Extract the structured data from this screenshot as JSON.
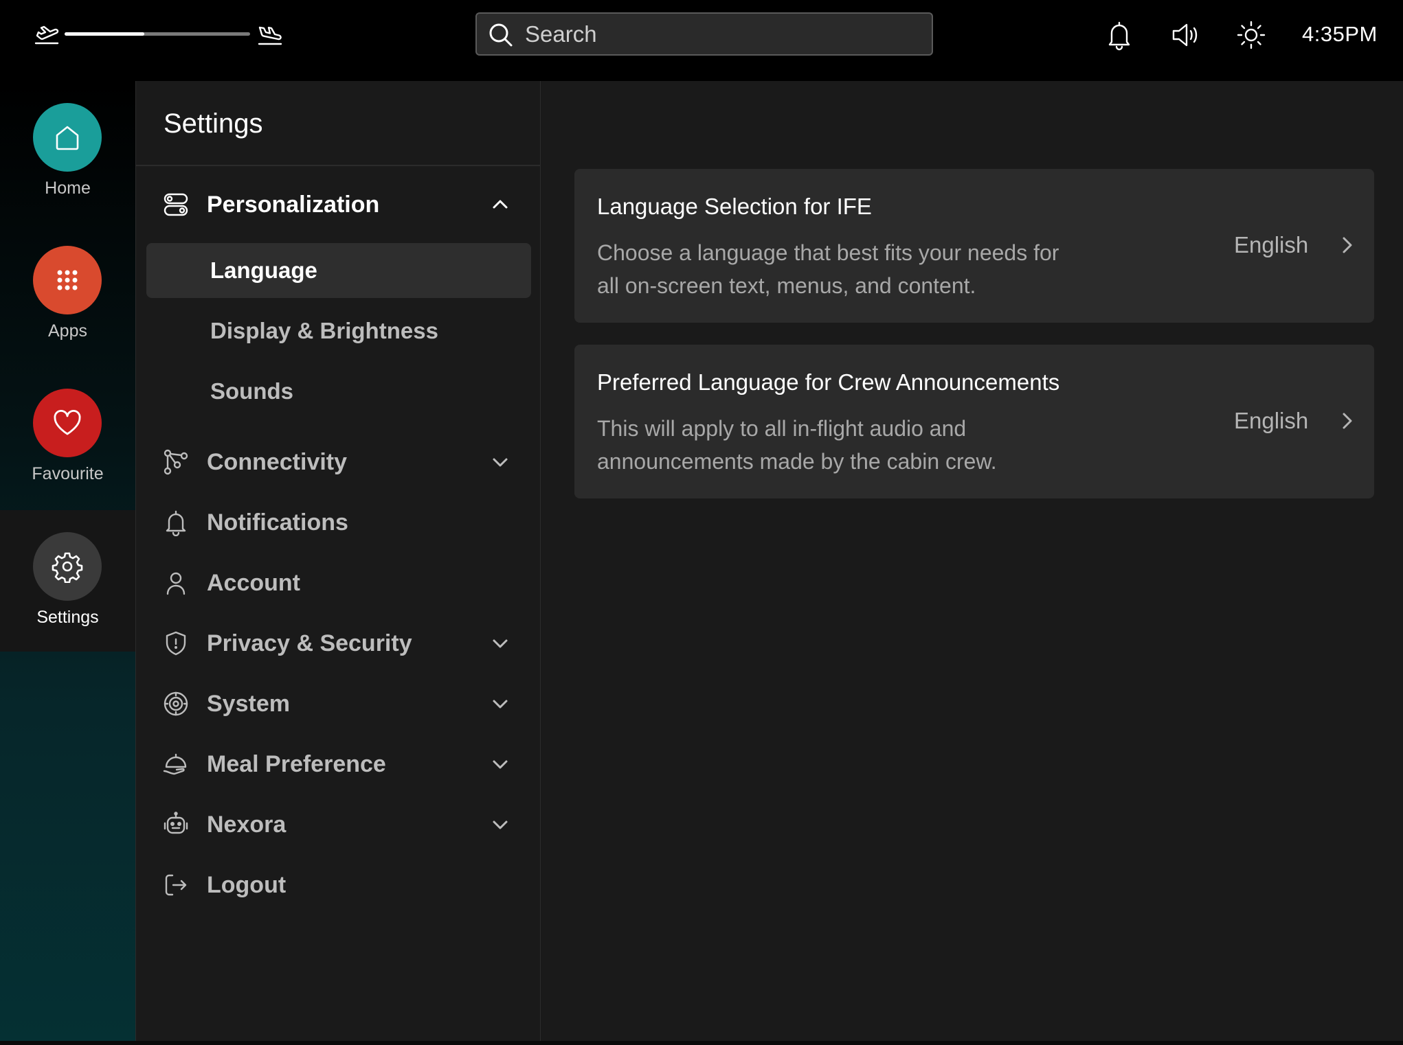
{
  "topbar": {
    "flight_progress": 0.43,
    "departure_icon": "plane-takeoff-icon",
    "arrival_icon": "plane-landing-icon",
    "search_placeholder": "Search",
    "icons": [
      "bell-icon",
      "volume-icon",
      "brightness-icon"
    ],
    "time": "4:35PM"
  },
  "rail": {
    "items": [
      {
        "label": "Home",
        "icon": "home-icon",
        "color": "#1a9e9a"
      },
      {
        "label": "Apps",
        "icon": "apps-grid-icon",
        "color": "#d94a2e"
      },
      {
        "label": "Favourite",
        "icon": "heart-icon",
        "color": "#c81e1e"
      },
      {
        "label": "Settings",
        "icon": "gear-icon",
        "color": "#3a3a3a",
        "active": true
      }
    ]
  },
  "nav": {
    "title": "Settings",
    "sections": [
      {
        "label": "Personalization",
        "icon": "toggles-icon",
        "expanded": true
      },
      {
        "label": "Connectivity",
        "icon": "connectivity-icon"
      },
      {
        "label": "Notifications",
        "icon": "bell-icon"
      },
      {
        "label": "Account",
        "icon": "user-icon"
      },
      {
        "label": "Privacy & Security",
        "icon": "shield-icon"
      },
      {
        "label": "System",
        "icon": "system-gear-icon"
      },
      {
        "label": "Meal Preference",
        "icon": "meal-icon"
      },
      {
        "label": "Nexora",
        "icon": "robot-icon"
      },
      {
        "label": "Logout",
        "icon": "logout-icon"
      }
    ],
    "personalization_items": [
      {
        "label": "Language",
        "active": true
      },
      {
        "label": "Display & Brightness"
      },
      {
        "label": "Sounds"
      }
    ]
  },
  "content": {
    "cards": [
      {
        "title": "Language Selection for IFE",
        "description": "Choose a language that best fits your needs for all on-screen text, menus, and content.",
        "value": "English"
      },
      {
        "title": "Preferred Language for Crew Announcements",
        "description": "This will apply to all in-flight audio and announcements made by the cabin crew.",
        "value": "English"
      }
    ]
  },
  "colors": {
    "background": "#000000",
    "panel": "#1a1a1a",
    "card": "#2b2b2b",
    "home_accent": "#1a9e9a",
    "apps_accent": "#d94a2e",
    "fav_accent": "#c81e1e"
  }
}
